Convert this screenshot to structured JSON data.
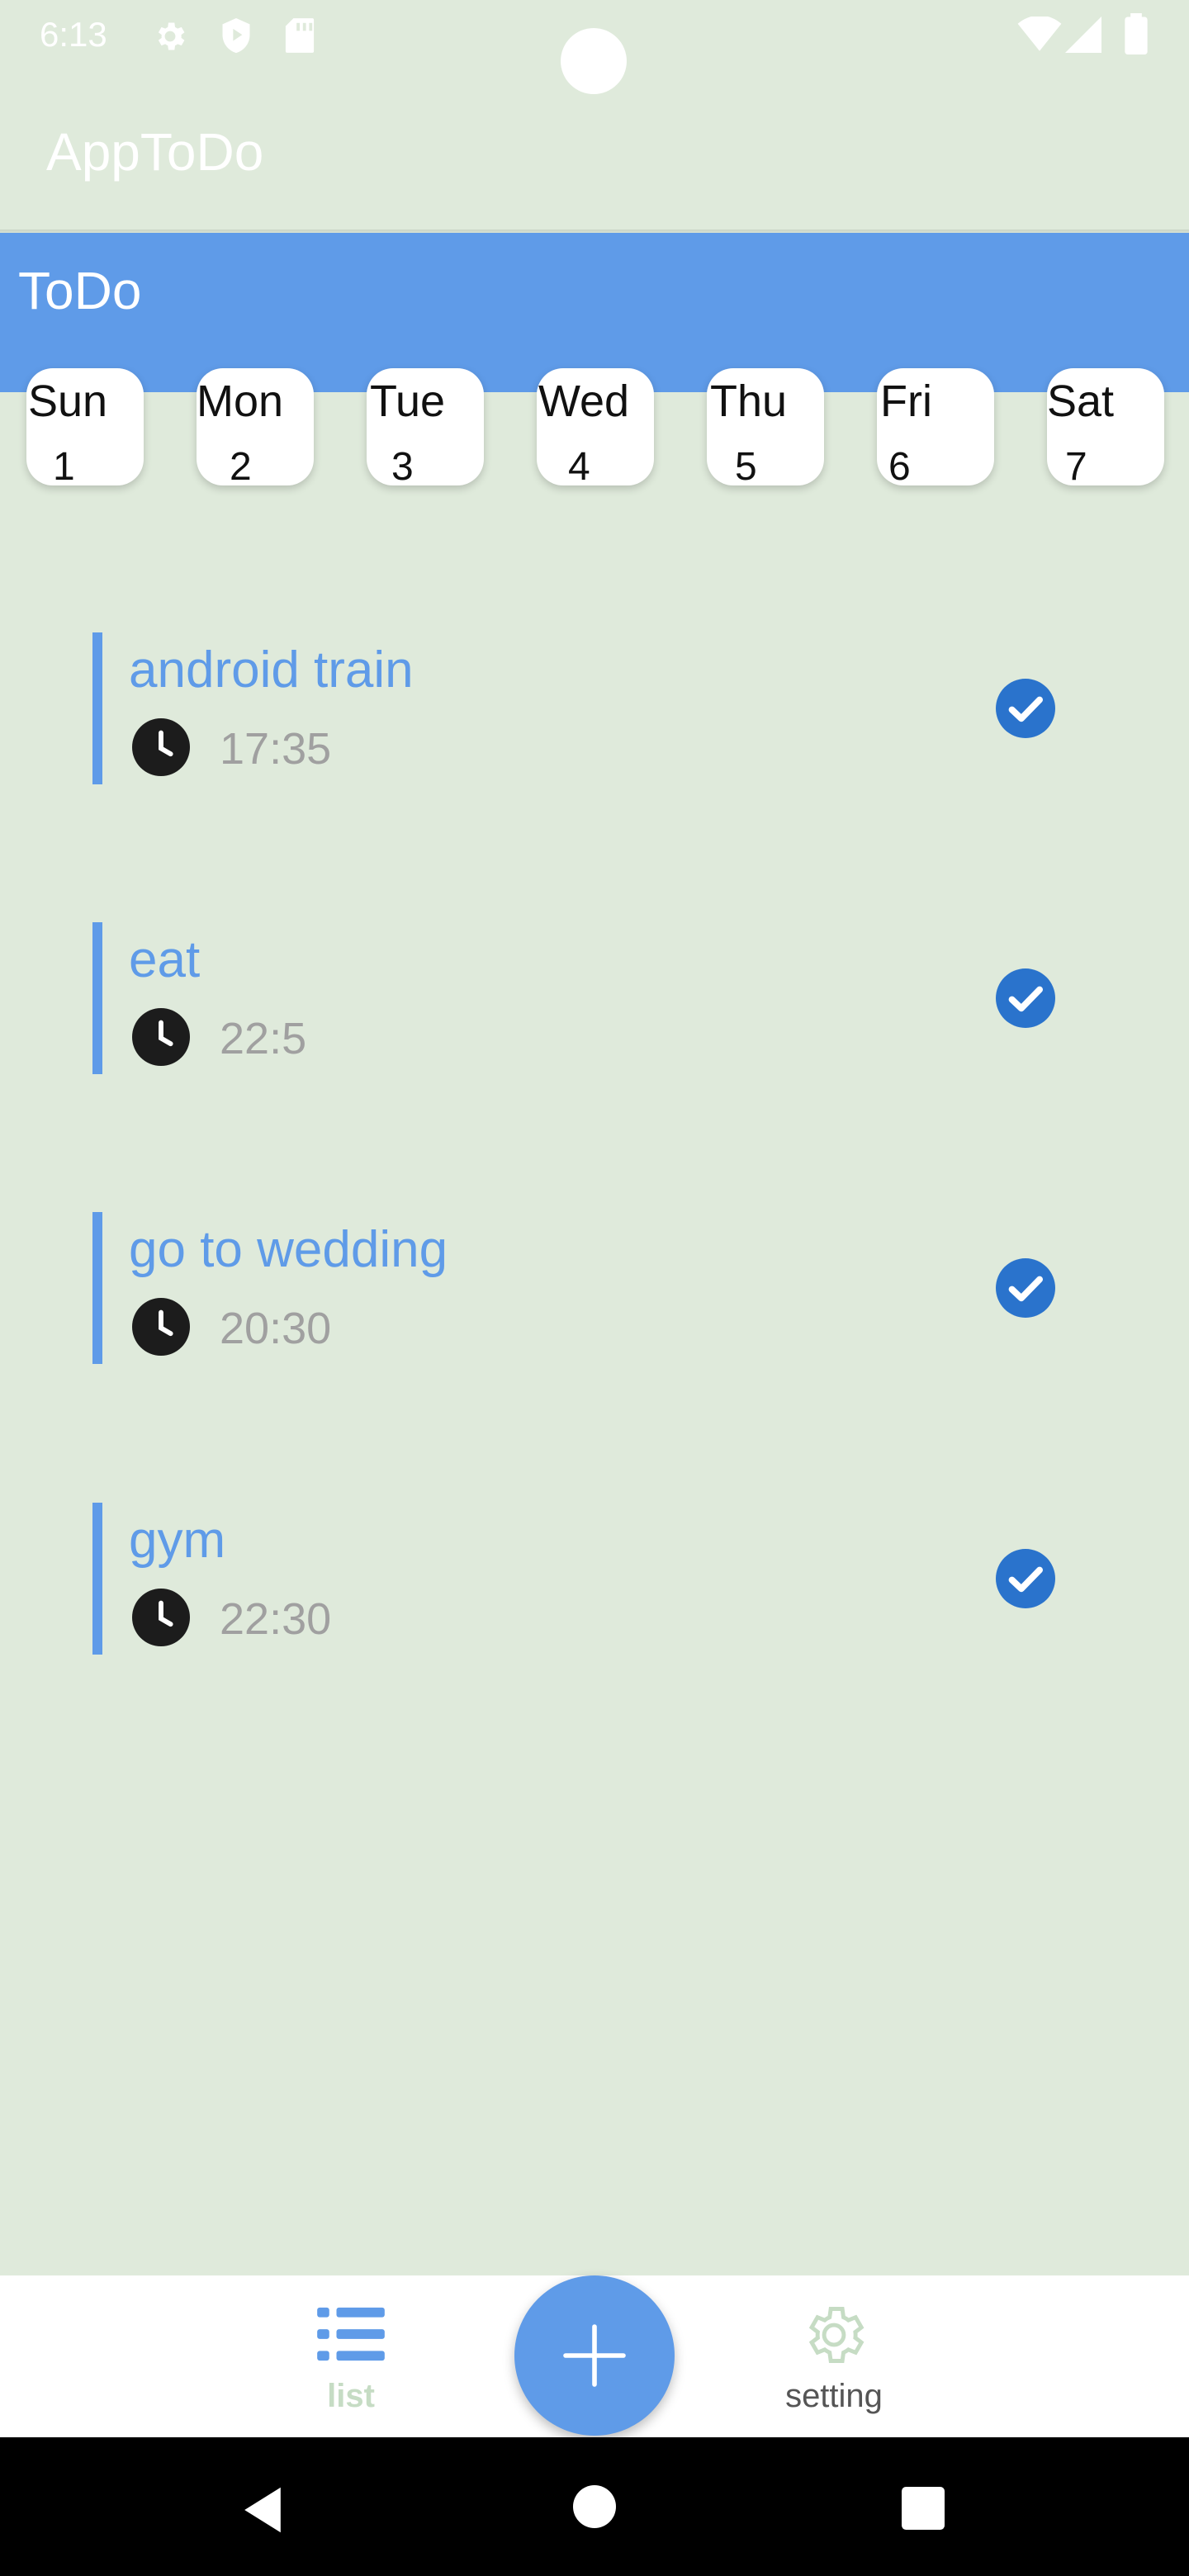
{
  "status_bar": {
    "time": "6:13",
    "icons": [
      "settings-icon",
      "shield-icon",
      "sd-card-icon",
      "wifi-icon",
      "signal-icon",
      "battery-icon"
    ]
  },
  "app": {
    "title": "AppToDo"
  },
  "header": {
    "title": "ToDo"
  },
  "week": {
    "days": [
      {
        "name": "Sun",
        "num": "1"
      },
      {
        "name": "Mon",
        "num": "2"
      },
      {
        "name": "Tue",
        "num": "3"
      },
      {
        "name": "Wed",
        "num": "4"
      },
      {
        "name": "Thu",
        "num": "5"
      },
      {
        "name": "Fri",
        "num": "6"
      },
      {
        "name": "Sat",
        "num": "7"
      }
    ]
  },
  "tasks": [
    {
      "title": "android train",
      "time": "17:35",
      "done": true
    },
    {
      "title": "eat",
      "time": "22:5",
      "done": true
    },
    {
      "title": "go to wedding",
      "time": "20:30",
      "done": true
    },
    {
      "title": "gym",
      "time": "22:30",
      "done": true
    }
  ],
  "bottom_nav": {
    "list_label": "list",
    "setting_label": "setting",
    "add_icon": "plus-icon"
  },
  "colors": {
    "background": "#dfeadb",
    "accent": "#5f9be8",
    "check": "#2a73cc",
    "muted_text": "#a0a0a0"
  }
}
